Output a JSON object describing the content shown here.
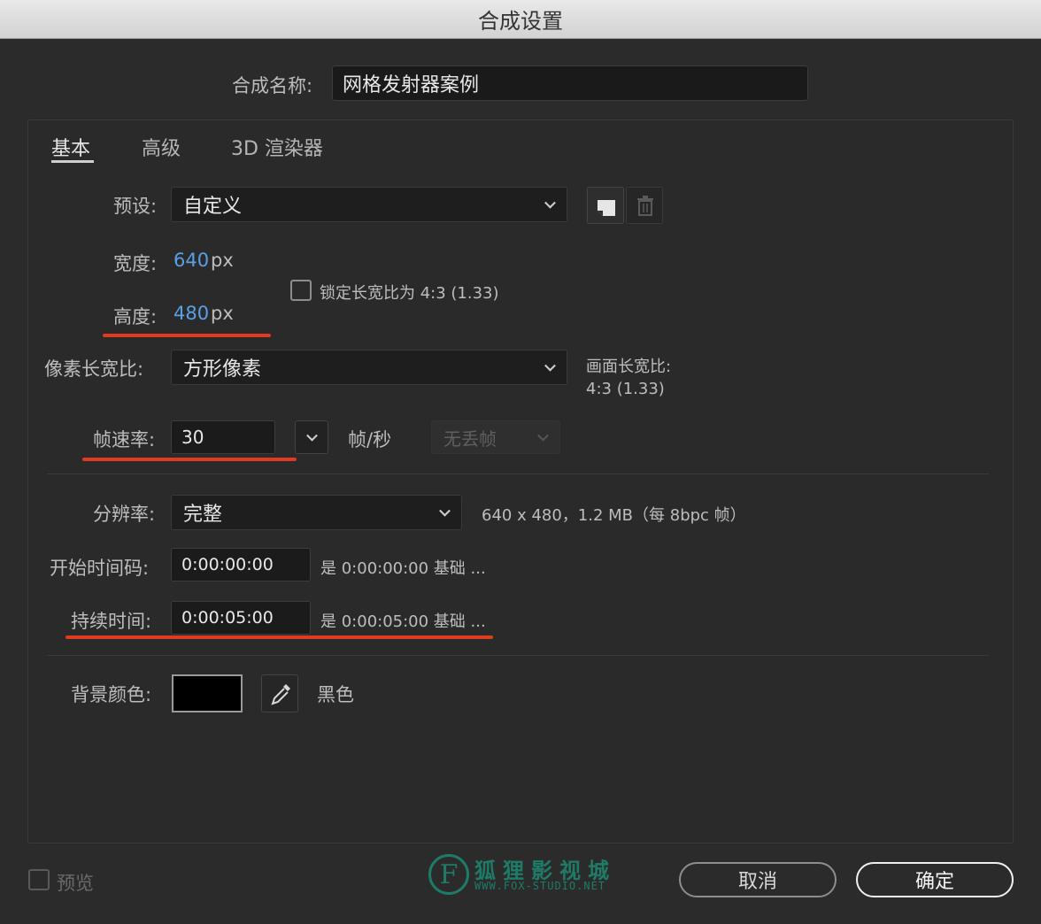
{
  "window": {
    "title": "合成设置"
  },
  "comp_name": {
    "label": "合成名称:",
    "value": "网格发射器案例"
  },
  "tabs": [
    {
      "label": "基本"
    },
    {
      "label": "高级"
    },
    {
      "label": "3D 渲染器"
    }
  ],
  "preset": {
    "label": "预设:",
    "value": "自定义"
  },
  "width": {
    "label": "宽度:",
    "value": "640",
    "unit": "px"
  },
  "height": {
    "label": "高度:",
    "value": "480",
    "unit": "px"
  },
  "lock_aspect": {
    "label": "锁定长宽比为 4:3 (1.33)",
    "checked": false
  },
  "pixel_aspect": {
    "label": "像素长宽比:",
    "value": "方形像素",
    "frame_aspect_label": "画面长宽比:",
    "frame_aspect_value": "4:3 (1.33)"
  },
  "frame_rate": {
    "label": "帧速率:",
    "value": "30",
    "unit": "帧/秒",
    "drop_frame": "无丢帧"
  },
  "resolution": {
    "label": "分辨率:",
    "value": "完整",
    "info": "640 x 480，1.2 MB（每 8bpc 帧）"
  },
  "start_timecode": {
    "label": "开始时间码:",
    "value": "0:00:00:00",
    "note": "是 0:00:00:00  基础 ..."
  },
  "duration": {
    "label": "持续时间:",
    "value": "0:00:05:00",
    "note": "是 0:00:05:00  基础 ..."
  },
  "background": {
    "label": "背景颜色:",
    "color_name": "黑色",
    "color": "#000000"
  },
  "preview": {
    "label": "预览",
    "checked": false
  },
  "watermark": {
    "logo_letter": "F",
    "name": "狐狸影视城",
    "url": "WWW.FOX-STUDIO.NET"
  },
  "buttons": {
    "cancel": "取消",
    "ok": "确定"
  },
  "colors": {
    "accent_value": "#5aa0e6",
    "annotation_red": "#e03a20",
    "watermark": "#1e7b67"
  },
  "icons": {
    "new_preset": "new-preset-icon",
    "delete_preset": "trash-icon",
    "eyedropper": "eyedropper-icon"
  }
}
